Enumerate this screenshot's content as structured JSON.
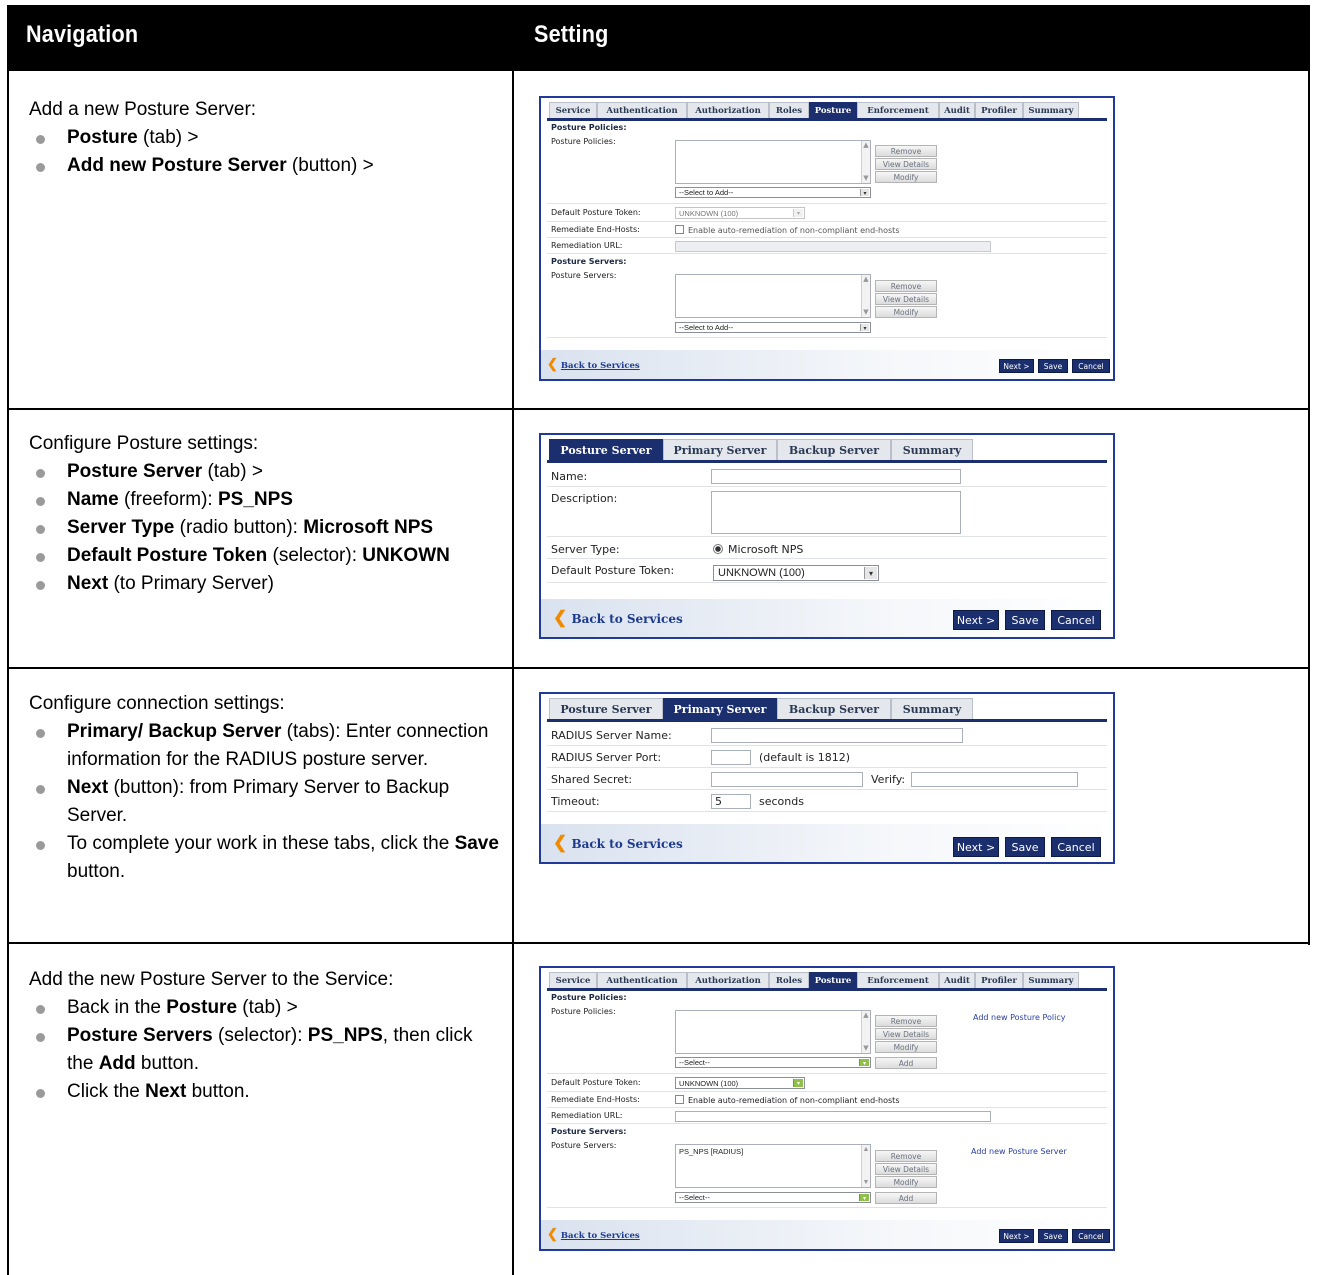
{
  "table": {
    "headers": {
      "navigation": "Navigation",
      "setting": "Setting"
    },
    "rows": [
      {
        "intro": "Add a new Posture Server:",
        "bullets": [
          {
            "bold": "Posture",
            "rest": " (tab) >"
          },
          {
            "bold": "Add new Posture Server ",
            "rest": " (button) >"
          }
        ]
      },
      {
        "intro": "Configure Posture settings:",
        "bullets": [
          {
            "bold": "Posture Server ",
            "rest": " (tab) >"
          },
          {
            "bold": "Name",
            "rest": " (freeform): ",
            "bold2": "PS_NPS"
          },
          {
            "bold": "Server Type",
            "rest": " (radio button): ",
            "bold2": "Microsoft NPS"
          },
          {
            "bold": "Default Posture Token",
            "rest": " (selector): ",
            "bold2": "UNKOWN"
          },
          {
            "bold": "Next",
            "rest": " (to Primary Server)"
          }
        ]
      },
      {
        "intro": "Configure connection settings:",
        "bullets": [
          {
            "bold": "Primary/ Backup Server",
            "rest": " (tabs): Enter connection information for the RADIUS posture server."
          },
          {
            "bold": "Next",
            "rest": " (button): from Primary Server to Backup Server."
          },
          {
            "pre": "To complete your work in these tabs, click the ",
            "bold": "Save",
            "rest": " button."
          }
        ]
      },
      {
        "intro": "Add the new Posture Server to the Service:",
        "bullets": [
          {
            "pre": "Back in the ",
            "bold": "Posture",
            "rest": " (tab) >"
          },
          {
            "bold": "Posture Servers",
            "rest": " (selector): ",
            "bold2": "PS_NPS",
            "rest2": ", then click the ",
            "bold3": "Add",
            "rest3": " button."
          },
          {
            "pre": "Click the ",
            "bold": "Next",
            "rest": " button."
          }
        ]
      }
    ]
  },
  "service_tabs": [
    "Service",
    "Authentication",
    "Authorization",
    "Roles",
    "Posture",
    "Enforcement",
    "Audit",
    "Profiler",
    "Summary"
  ],
  "service_form": {
    "section_policies": "Posture Policies:",
    "label_policies": "Posture Policies:",
    "label_default_token": "Default Posture Token:",
    "label_remediate": "Remediate End-Hosts:",
    "remediate_text": "Enable auto-remediation of non-compliant end-hosts",
    "label_remediation_url": "Remediation URL:",
    "section_servers": "Posture Servers:",
    "label_servers": "Posture Servers:",
    "btn_remove": "Remove",
    "btn_view": "View Details",
    "btn_modify": "Modify",
    "btn_add": "Add",
    "select_to_add": "--Select to Add--",
    "select": "--Select--",
    "token_value": "UNKNOWN (100)",
    "server_entry": "PS_NPS [RADIUS]",
    "link_new_policy": "Add new Posture Policy",
    "link_new_server": "Add new Posture Server"
  },
  "posture_tabs": [
    "Posture Server",
    "Primary Server",
    "Backup Server",
    "Summary"
  ],
  "posture_form": {
    "label_name": "Name:",
    "label_description": "Description:",
    "label_server_type": "Server Type:",
    "server_type_value": "Microsoft NPS",
    "label_default_token": "Default Posture Token:",
    "token_value": "UNKNOWN (100)"
  },
  "primary_form": {
    "label_radius_name": "RADIUS Server Name:",
    "label_radius_port": "RADIUS Server Port:",
    "port_hint": "(default is 1812)",
    "label_secret": "Shared Secret:",
    "label_verify": "Verify:",
    "label_timeout": "Timeout:",
    "timeout_value": "5",
    "timeout_unit": "seconds"
  },
  "actions": {
    "back": "Back to Services",
    "next": "Next >",
    "save": "Save",
    "cancel": "Cancel"
  }
}
